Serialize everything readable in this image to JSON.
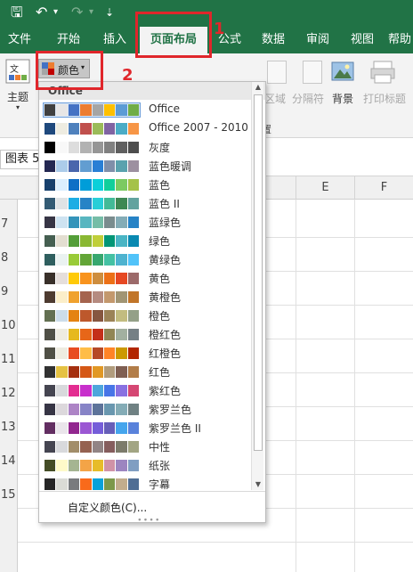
{
  "quick_access": {
    "save_glyph": "🖫",
    "undo_glyph": "↶",
    "redo_glyph": "↷",
    "customize_glyph": "⇣"
  },
  "tabs": [
    {
      "label": "文件",
      "active": false
    },
    {
      "label": "开始",
      "active": false
    },
    {
      "label": "插入",
      "active": false
    },
    {
      "label": "页面布局",
      "active": true
    },
    {
      "label": "公式",
      "active": false
    },
    {
      "label": "数据",
      "active": false
    },
    {
      "label": "审阅",
      "active": false
    },
    {
      "label": "视图",
      "active": false
    },
    {
      "label": "帮助",
      "active": false
    }
  ],
  "ribbon": {
    "theme_label": "主题",
    "colors_label": "颜色",
    "area_label": "区域",
    "page_break_label": "分隔符",
    "background_label": "背景",
    "print_titles_label": "打印标题",
    "group_label": "置"
  },
  "name_box": "图表 5",
  "columns": [
    "E",
    "F"
  ],
  "rows": [
    "7",
    "8",
    "9",
    "10",
    "11",
    "12",
    "13",
    "14",
    "15"
  ],
  "dropdown": {
    "header": "Office",
    "custom_label": "自定义颜色(C)...",
    "themes": [
      {
        "name": "Office",
        "selected": true,
        "colors": [
          "#404040",
          "#e7e6e6",
          "#4472c4",
          "#ed7d31",
          "#a5a5a5",
          "#ffc000",
          "#5b9bd5",
          "#70ad47"
        ]
      },
      {
        "name": "Office 2007 - 2010",
        "selected": false,
        "colors": [
          "#1f497d",
          "#eeece1",
          "#4f81bd",
          "#c0504d",
          "#9bbb59",
          "#8064a2",
          "#4bacc6",
          "#f79646"
        ]
      },
      {
        "name": "灰度",
        "selected": false,
        "colors": [
          "#000000",
          "#f8f8f8",
          "#dddddd",
          "#b2b2b2",
          "#969696",
          "#808080",
          "#5f5f5f",
          "#4d4d4d"
        ]
      },
      {
        "name": "蓝色暖调",
        "selected": false,
        "colors": [
          "#242852",
          "#acccea",
          "#4a66ac",
          "#629dd1",
          "#297fd5",
          "#7f8fa9",
          "#5aa2ae",
          "#9d90a0"
        ]
      },
      {
        "name": "蓝色",
        "selected": false,
        "colors": [
          "#17406d",
          "#dbefff",
          "#0f6fc6",
          "#009dd9",
          "#0bd0d9",
          "#10cf9b",
          "#7cca62",
          "#a5c249"
        ]
      },
      {
        "name": "蓝色 II",
        "selected": false,
        "colors": [
          "#335b74",
          "#dfe3e5",
          "#1cade4",
          "#2683c6",
          "#27ced7",
          "#42ba97",
          "#3e8853",
          "#62a39f"
        ]
      },
      {
        "name": "蓝绿色",
        "selected": false,
        "colors": [
          "#373545",
          "#cee3f1",
          "#3494ba",
          "#58b6c0",
          "#75bda7",
          "#7a8c8e",
          "#84acb6",
          "#2683c6"
        ]
      },
      {
        "name": "绿色",
        "selected": false,
        "colors": [
          "#455f51",
          "#e3ded1",
          "#549e39",
          "#8ab833",
          "#c0cf3a",
          "#029676",
          "#4ab5c4",
          "#0989b1"
        ]
      },
      {
        "name": "黄绿色",
        "selected": false,
        "colors": [
          "#2f5f5f",
          "#eaf2f1",
          "#99cb38",
          "#63a537",
          "#37a76f",
          "#44c1a3",
          "#4eb3cf",
          "#51c3f9"
        ]
      },
      {
        "name": "黄色",
        "selected": false,
        "colors": [
          "#39302a",
          "#e5dedb",
          "#ffca08",
          "#f8931d",
          "#ce8d3e",
          "#ec7016",
          "#e64823",
          "#9c6a6a"
        ]
      },
      {
        "name": "黄橙色",
        "selected": false,
        "colors": [
          "#4e3b30",
          "#fbeec9",
          "#f0a22e",
          "#a5644e",
          "#b58b80",
          "#c3986d",
          "#a19574",
          "#c17529"
        ]
      },
      {
        "name": "橙色",
        "selected": false,
        "colors": [
          "#637052",
          "#ccddea",
          "#e48312",
          "#bd582c",
          "#865640",
          "#9b8357",
          "#c2bc80",
          "#94a088"
        ]
      },
      {
        "name": "橙红色",
        "selected": false,
        "colors": [
          "#505046",
          "#eeece1",
          "#e6b91e",
          "#e76618",
          "#c42f1a",
          "#918655",
          "#a2b0a0",
          "#758085"
        ]
      },
      {
        "name": "红橙色",
        "selected": false,
        "colors": [
          "#505046",
          "#eeece1",
          "#e84c22",
          "#ffbd47",
          "#b64926",
          "#ff8427",
          "#cc9900",
          "#b22600"
        ]
      },
      {
        "name": "红色",
        "selected": false,
        "colors": [
          "#323232",
          "#e5c243",
          "#a5300f",
          "#d55816",
          "#e19825",
          "#b19c7d",
          "#7f5f52",
          "#b27d49"
        ]
      },
      {
        "name": "紫红色",
        "selected": false,
        "colors": [
          "#454551",
          "#d8d9dc",
          "#e32d91",
          "#c830cc",
          "#4ea6dc",
          "#4775e7",
          "#8971e1",
          "#d54773"
        ]
      },
      {
        "name": "紫罗兰色",
        "selected": false,
        "colors": [
          "#373545",
          "#dcd8dc",
          "#ad84c6",
          "#8784c7",
          "#5d739a",
          "#6997af",
          "#84acb6",
          "#6f8183"
        ]
      },
      {
        "name": "紫罗兰色 II",
        "selected": false,
        "colors": [
          "#632e62",
          "#eae5eb",
          "#92278f",
          "#9b57d3",
          "#755dd9",
          "#665eb8",
          "#45a5ed",
          "#5982db"
        ]
      },
      {
        "name": "中性",
        "selected": false,
        "colors": [
          "#454551",
          "#d8d9dc",
          "#a28e6a",
          "#956251",
          "#918485",
          "#855d5d",
          "#7c7b6b",
          "#a2a583"
        ]
      },
      {
        "name": "纸张",
        "selected": false,
        "colors": [
          "#444d26",
          "#fefac9",
          "#a5b592",
          "#f3a447",
          "#e7bc29",
          "#d092a7",
          "#9c85c0",
          "#809ec2"
        ]
      },
      {
        "name": "字幕",
        "selected": false,
        "colors": [
          "#262626",
          "#dadbd6",
          "#797b7e",
          "#f96a1b",
          "#08a1d9",
          "#7c984a",
          "#c2ad8d",
          "#506e94"
        ]
      }
    ]
  },
  "annotations": {
    "label_1": "1",
    "label_2": "2"
  }
}
